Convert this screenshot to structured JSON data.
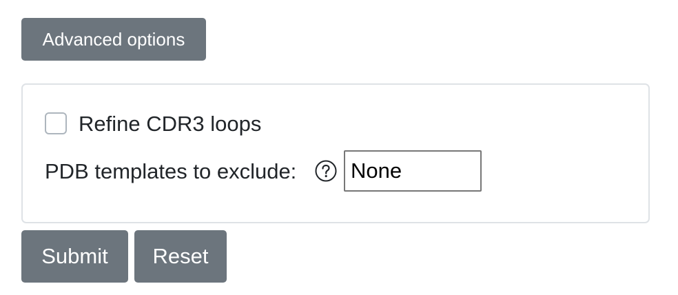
{
  "advanced": {
    "button_label": "Advanced options"
  },
  "options": {
    "refine_label": "Refine CDR3 loops",
    "refine_checked": false,
    "exclude_label": "PDB templates to exclude:",
    "exclude_value": "None",
    "help_icon": "question-circle-icon"
  },
  "actions": {
    "submit_label": "Submit",
    "reset_label": "Reset"
  },
  "colors": {
    "button_bg": "#6c757d",
    "card_border": "#dee2e6",
    "text": "#212529"
  }
}
